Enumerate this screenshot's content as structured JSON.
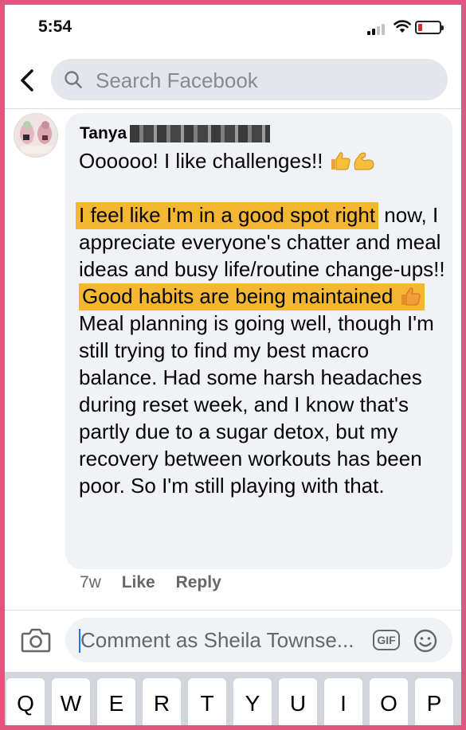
{
  "status_bar": {
    "time": "5:54"
  },
  "search": {
    "placeholder": "Search Facebook"
  },
  "comment": {
    "author": "Tanya",
    "line1": "Oooooo! I like challenges!! ",
    "hl1": "I feel like I'm in a good spot right",
    "para2_rest": "now,  I appreciate everyone's chatter and meal ideas and busy life/routine change-ups!!",
    "hl2a": "Good habits are being",
    "hl2b": "maintained ",
    "para3": "Meal planning is going well, though I'm still trying to find my best macro balance. Had some harsh headaches during reset week, and I know that's partly due to a sugar detox, but my recovery between workouts has been poor. So I'm still playing with that.",
    "time": "7w",
    "like_label": "Like",
    "reply_label": "Reply"
  },
  "composer": {
    "placeholder": "Comment as Sheila Townse...",
    "gif_label": "GIF"
  },
  "keyboard": {
    "keys": [
      "Q",
      "W",
      "E",
      "R",
      "T",
      "Y",
      "U",
      "I",
      "O",
      "P"
    ]
  },
  "colors": {
    "highlight": "#f5b731",
    "bubble": "#f0f2f5",
    "frame": "#e0567f",
    "link": "#1877f2"
  }
}
